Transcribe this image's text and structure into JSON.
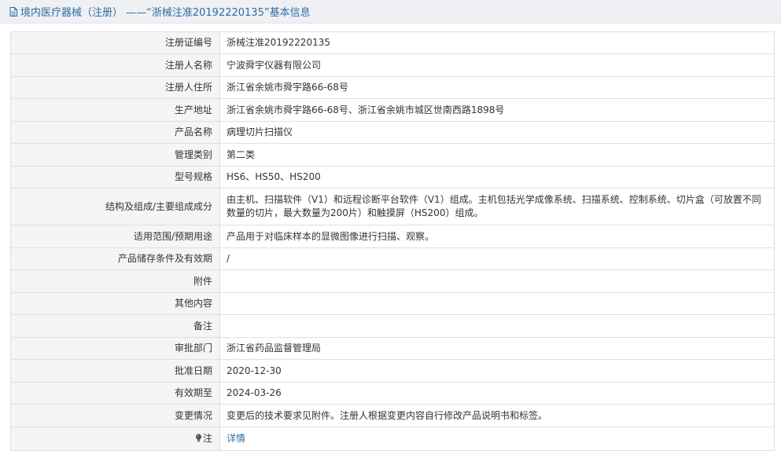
{
  "header": {
    "title": "境内医疗器械（注册）  ——“浙械注准20192220135”基本信息",
    "icon": "document-icon"
  },
  "colors": {
    "title_text": "#2d6ca2",
    "label_bg": "#f4f5f7",
    "border": "#dcdfe5",
    "link": "#2d6ca2"
  },
  "rows": [
    {
      "label": "注册证编号",
      "value": "浙械注准20192220135"
    },
    {
      "label": "注册人名称",
      "value": "宁波舜宇仪器有限公司"
    },
    {
      "label": "注册人住所",
      "value": "浙江省余姚市舜宇路66-68号"
    },
    {
      "label": "生产地址",
      "value": "浙江省余姚市舜宇路66-68号、浙江省余姚市城区世南西路1898号"
    },
    {
      "label": "产品名称",
      "value": "病理切片扫描仪"
    },
    {
      "label": "管理类别",
      "value": "第二类"
    },
    {
      "label": "型号规格",
      "value": "HS6、HS50、HS200"
    },
    {
      "label": "结构及组成/主要组成成分",
      "value": "由主机、扫描软件（V1）和远程诊断平台软件（V1）组成。主机包括光学成像系统、扫描系统、控制系统、切片盒（可放置不同数量的切片，最大数量为200片）和触摸屏（HS200）组成。"
    },
    {
      "label": "适用范围/预期用途",
      "value": "产品用于对临床样本的显微图像进行扫描、观察。"
    },
    {
      "label": "产品储存条件及有效期",
      "value": "/"
    },
    {
      "label": "附件",
      "value": ""
    },
    {
      "label": "其他内容",
      "value": ""
    },
    {
      "label": "备注",
      "value": ""
    },
    {
      "label": "审批部门",
      "value": "浙江省药品监督管理局"
    },
    {
      "label": "批准日期",
      "value": "2020-12-30"
    },
    {
      "label": "有效期至",
      "value": "2024-03-26"
    },
    {
      "label": "变更情况",
      "value": "变更后的技术要求见附件。注册人根据变更内容自行修改产品说明书和标签。"
    }
  ],
  "note_row": {
    "label": "注",
    "icon": "lightbulb-icon",
    "link_text": "详情"
  }
}
